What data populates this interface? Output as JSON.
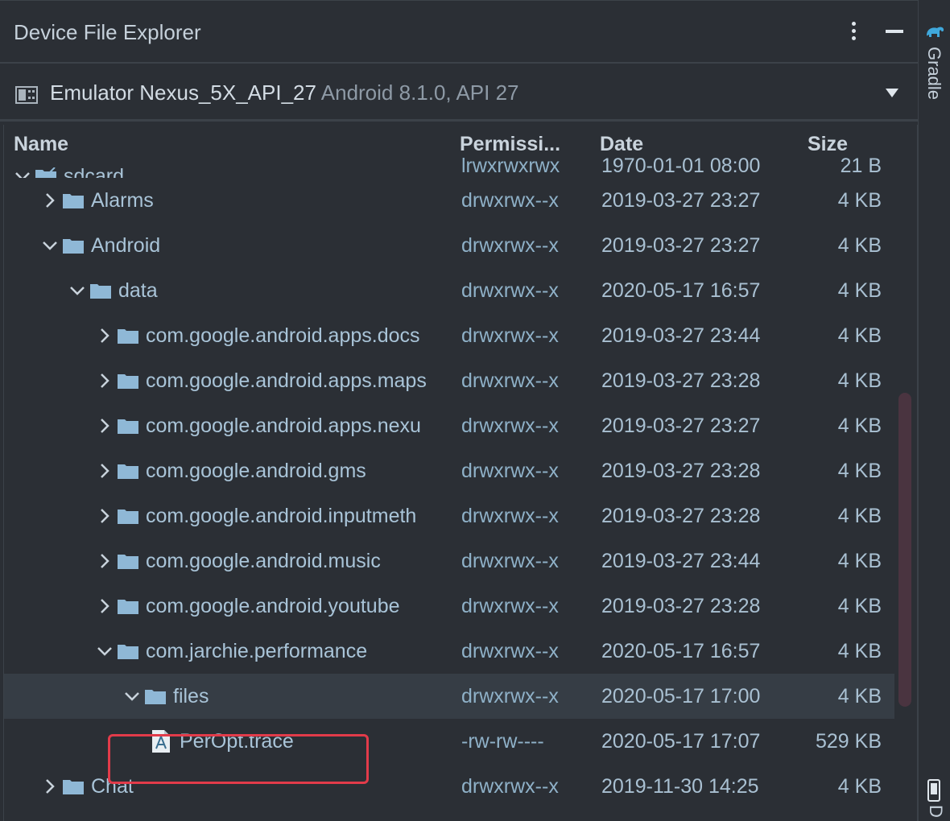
{
  "panel": {
    "title": "Device File Explorer",
    "menu_icon": "kebab-menu-icon",
    "minimize_icon": "minimize-icon"
  },
  "device": {
    "name": "Emulator Nexus_5X_API_27",
    "details": "Android 8.1.0, API 27",
    "icon": "device-icon"
  },
  "columns": {
    "name": "Name",
    "permissions": "Permissi...",
    "date": "Date",
    "size": "Size"
  },
  "rows": [
    {
      "label": "sdcard",
      "perm": "lrwxrwxrwx",
      "date": "1970-01-01 08:00",
      "size": "21 B",
      "depth": 0,
      "expanded": true,
      "type": "link-folder"
    },
    {
      "label": "Alarms",
      "perm": "drwxrwx--x",
      "date": "2019-03-27 23:27",
      "size": "4 KB",
      "depth": 1,
      "expanded": false,
      "type": "folder"
    },
    {
      "label": "Android",
      "perm": "drwxrwx--x",
      "date": "2019-03-27 23:27",
      "size": "4 KB",
      "depth": 1,
      "expanded": true,
      "type": "folder"
    },
    {
      "label": "data",
      "perm": "drwxrwx--x",
      "date": "2020-05-17 16:57",
      "size": "4 KB",
      "depth": 2,
      "expanded": true,
      "type": "folder"
    },
    {
      "label": "com.google.android.apps.docs",
      "perm": "drwxrwx--x",
      "date": "2019-03-27 23:44",
      "size": "4 KB",
      "depth": 3,
      "expanded": false,
      "type": "folder"
    },
    {
      "label": "com.google.android.apps.maps",
      "perm": "drwxrwx--x",
      "date": "2019-03-27 23:28",
      "size": "4 KB",
      "depth": 3,
      "expanded": false,
      "type": "folder"
    },
    {
      "label": "com.google.android.apps.nexu",
      "perm": "drwxrwx--x",
      "date": "2019-03-27 23:27",
      "size": "4 KB",
      "depth": 3,
      "expanded": false,
      "type": "folder"
    },
    {
      "label": "com.google.android.gms",
      "perm": "drwxrwx--x",
      "date": "2019-03-27 23:28",
      "size": "4 KB",
      "depth": 3,
      "expanded": false,
      "type": "folder"
    },
    {
      "label": "com.google.android.inputmeth",
      "perm": "drwxrwx--x",
      "date": "2019-03-27 23:28",
      "size": "4 KB",
      "depth": 3,
      "expanded": false,
      "type": "folder"
    },
    {
      "label": "com.google.android.music",
      "perm": "drwxrwx--x",
      "date": "2019-03-27 23:44",
      "size": "4 KB",
      "depth": 3,
      "expanded": false,
      "type": "folder"
    },
    {
      "label": "com.google.android.youtube",
      "perm": "drwxrwx--x",
      "date": "2019-03-27 23:28",
      "size": "4 KB",
      "depth": 3,
      "expanded": false,
      "type": "folder"
    },
    {
      "label": "com.jarchie.performance",
      "perm": "drwxrwx--x",
      "date": "2020-05-17 16:57",
      "size": "4 KB",
      "depth": 3,
      "expanded": true,
      "type": "folder"
    },
    {
      "label": "files",
      "perm": "drwxrwx--x",
      "date": "2020-05-17 17:00",
      "size": "4 KB",
      "depth": 4,
      "expanded": true,
      "type": "folder",
      "selected": true
    },
    {
      "label": "PerOpt.trace",
      "perm": "-rw-rw----",
      "date": "2020-05-17 17:07",
      "size": "529 KB",
      "depth": 5,
      "type": "file"
    },
    {
      "label": "Chat",
      "perm": "drwxrwx--x",
      "date": "2019-11-30 14:25",
      "size": "4 KB",
      "depth": 1,
      "expanded": false,
      "type": "folder"
    }
  ],
  "side": {
    "gradle_label": "Gradle",
    "gradle_icon": "gradle-elephant-icon",
    "device_label": "D",
    "device_icon": "phone-icon"
  },
  "colors": {
    "background": "#2b2f35",
    "folder": "#8fb8d6",
    "highlight_border": "#e23b4a",
    "selected_row": "#363d45"
  }
}
